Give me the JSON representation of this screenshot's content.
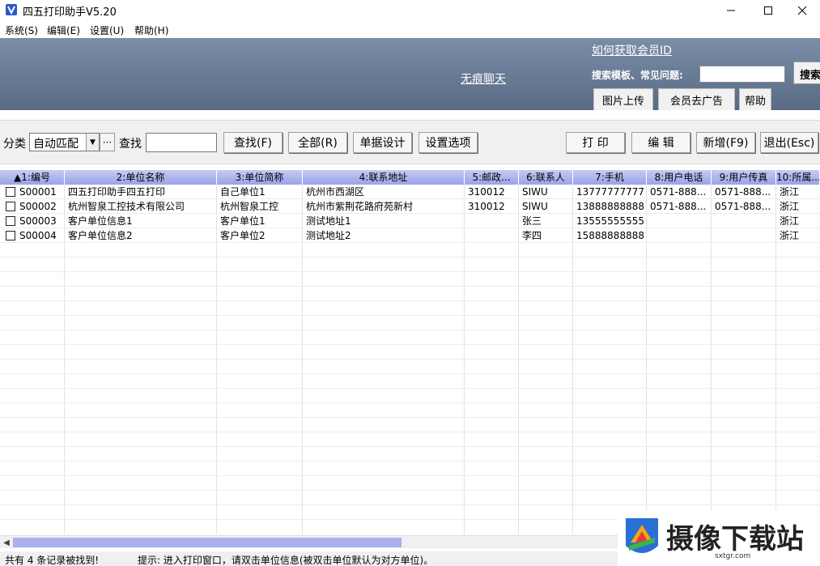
{
  "window": {
    "title": "四五打印助手V5.20"
  },
  "menu": {
    "items": [
      "系统(S)",
      "编辑(E)",
      "设置(U)",
      "帮助(H)"
    ]
  },
  "banner": {
    "chat_link": "无痕聊天",
    "member_link": "如何获取会员ID",
    "search_label": "搜索模板、常见问题:",
    "search_placeholder": "",
    "search_button": "搜索",
    "tabs": [
      "图片上传",
      "会员去广告",
      "帮助"
    ]
  },
  "toolbar": {
    "category_label": "分类",
    "category_value": "自动匹配",
    "dots_label": "···",
    "find_label": "查找",
    "find_value": "",
    "buttons": {
      "find": "查找(F)",
      "all": "全部(R)",
      "design": "单据设计",
      "options": "设置选项",
      "print": "打 印",
      "edit": "编 辑",
      "add": "新增(F9)",
      "exit": "退出(Esc)"
    }
  },
  "grid": {
    "columns": [
      "▲1:编号",
      "2:单位名称",
      "3:单位简称",
      "4:联系地址",
      "5:邮政...",
      "6:联系人",
      "7:手机",
      "8:用户电话",
      "9:用户传真",
      "10:所属..."
    ],
    "rows": [
      [
        "S00001",
        "四五打印助手四五打印",
        "自己单位1",
        "杭州市西湖区",
        "310012",
        "SIWU",
        "13777777777",
        "0571-888...",
        "0571-888...",
        "浙江"
      ],
      [
        "S00002",
        "杭州智泉工控技术有限公司",
        "杭州智泉工控",
        "杭州市紫荆花路府苑新村",
        "310012",
        "SIWU",
        "13888888888",
        "0571-888...",
        "0571-888...",
        "浙江"
      ],
      [
        "S00003",
        "客户单位信息1",
        "客户单位1",
        "测试地址1",
        "",
        "张三",
        "13555555555",
        "",
        "",
        "浙江"
      ],
      [
        "S00004",
        "客户单位信息2",
        "客户单位2",
        "测试地址2",
        "",
        "李四",
        "15888888888",
        "",
        "",
        "浙江"
      ]
    ]
  },
  "status": {
    "count": "共有 4 条记录被找到!",
    "hint": "提示: 进入打印窗口，请双击单位信息(被双击单位默认为对方单位)。"
  },
  "watermark": {
    "text": "摄像下载站",
    "url": "sxtgr.com"
  },
  "colors": {
    "banner": "#6a7d98",
    "grid_header": "#aab2ec",
    "scroll_thumb": "#a9b0ec"
  }
}
